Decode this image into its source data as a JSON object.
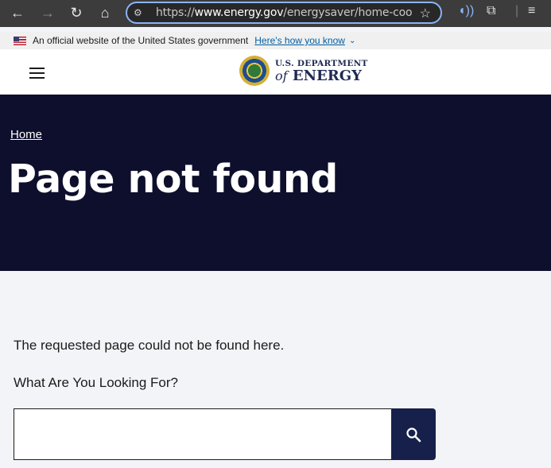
{
  "browser": {
    "url_prefix": "https://",
    "url_host": "www.energy.gov",
    "url_path": "/energysaver/home-cooling"
  },
  "gov_banner": {
    "text": "An official website of the United States government",
    "link_label": "Here's how you know"
  },
  "header": {
    "logo_line1": "U.S. DEPARTMENT",
    "logo_of": "of",
    "logo_line2": "ENERGY"
  },
  "hero": {
    "breadcrumb": "Home",
    "title": "Page not found"
  },
  "main": {
    "message": "The requested page could not be found here.",
    "prompt": "What Are You Looking For?",
    "search_value": ""
  }
}
